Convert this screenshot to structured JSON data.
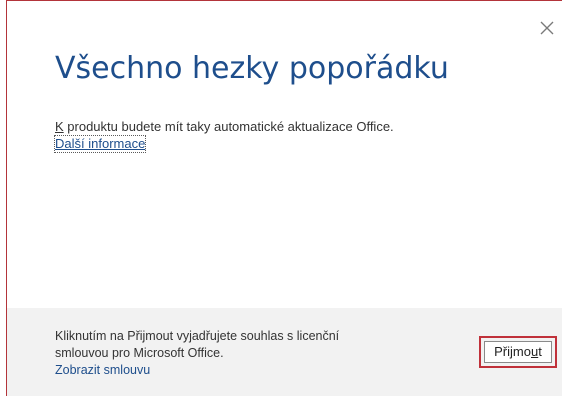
{
  "dialog": {
    "title": "Všechno hezky popořádku",
    "close_icon": "close-icon",
    "body": {
      "updates_text_first": "K",
      "updates_text_rest": " produktu budete mít taky automatické aktualizace Office.",
      "more_info_link": "Další informace"
    },
    "footer": {
      "license_line_1": "Kliknutím na Přijmout vyjadřujete souhlas s licenční",
      "license_line_2": "smlouvou pro Microsoft Office.",
      "view_agreement_link": "Zobrazit smlouvu",
      "accept_button_before": "Přijmo",
      "accept_button_mnemonic": "u",
      "accept_button_after": "t"
    },
    "colors": {
      "title": "#1e4e8c",
      "link": "#1e4e8c",
      "highlight_border": "#c0313a",
      "footer_background": "#f2f2f2"
    }
  }
}
